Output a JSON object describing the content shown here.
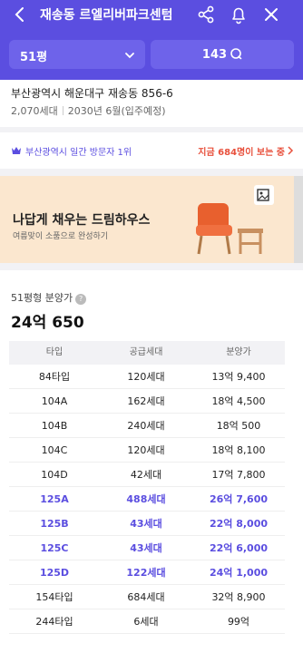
{
  "header": {
    "title": "재송동 르엘리버파크센텀",
    "size_select": "51평",
    "talk_count": "143",
    "bg_color": "#5b4ee0"
  },
  "address": {
    "street": "부산광역시 해운대구 재송동 856-6",
    "households": "2,070세대",
    "move_in": "2030년 6월(입주예정)"
  },
  "visitor": {
    "rank_text": "부산광역시 일간 방문자 1위",
    "now_viewing": "지금 684명이 보는 중"
  },
  "banner": {
    "headline": "나답게 채우는 드림하우스",
    "sub": "여름맞이 소품으로 완성하기"
  },
  "price": {
    "label": "51평형 분양가",
    "value": "24억 650",
    "table": {
      "headers": [
        "타입",
        "공급세대",
        "분양가"
      ],
      "rows": [
        {
          "type": "84타입",
          "units": "120세대",
          "price": "13억 9,400"
        },
        {
          "type": "104A",
          "units": "162세대",
          "price": "18억 4,500"
        },
        {
          "type": "104B",
          "units": "240세대",
          "price": "18억 500"
        },
        {
          "type": "104C",
          "units": "120세대",
          "price": "18억 8,100"
        },
        {
          "type": "104D",
          "units": "42세대",
          "price": "17억 7,800"
        },
        {
          "type": "125A",
          "units": "488세대",
          "price": "26억 7,600"
        },
        {
          "type": "125B",
          "units": "43세대",
          "price": "22억 8,000"
        },
        {
          "type": "125C",
          "units": "43세대",
          "price": "22억 6,000"
        },
        {
          "type": "125D",
          "units": "122세대",
          "price": "24억 1,000"
        },
        {
          "type": "154타입",
          "units": "684세대",
          "price": "32억 8,900"
        },
        {
          "type": "244타입",
          "units": "6세대",
          "price": "99억"
        }
      ]
    }
  }
}
